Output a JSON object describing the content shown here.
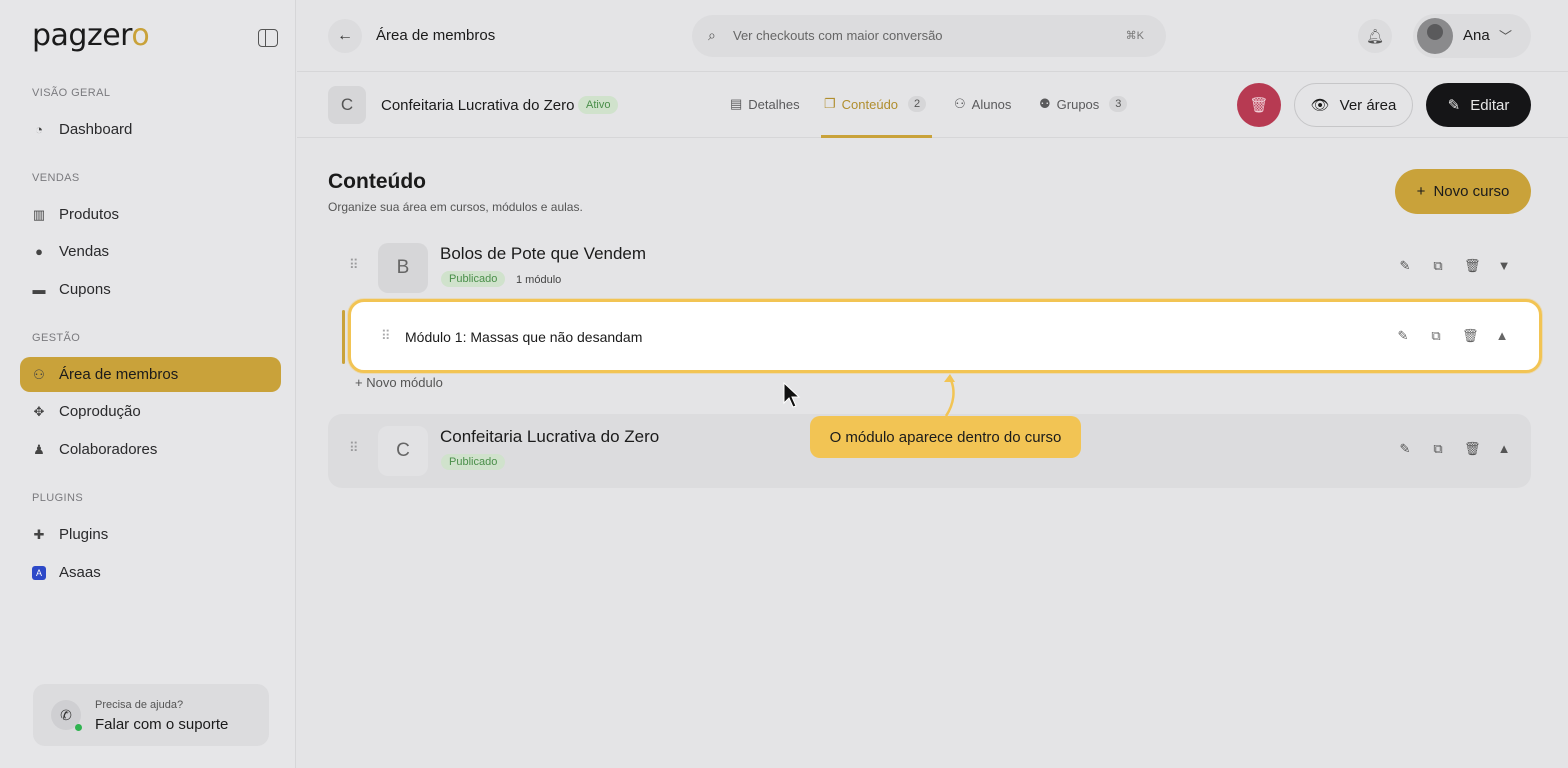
{
  "brand": {
    "name_main": "pagzer",
    "name_accent": "o",
    "accent_color": "#c9a23a"
  },
  "sidebar": {
    "sections": [
      {
        "title": "VISÃO GERAL",
        "items": [
          {
            "label": "Dashboard",
            "icon": "gauge-icon"
          }
        ]
      },
      {
        "title": "VENDAS",
        "items": [
          {
            "label": "Produtos",
            "icon": "box-icon"
          },
          {
            "label": "Vendas",
            "icon": "money-icon"
          },
          {
            "label": "Cupons",
            "icon": "ticket-icon"
          }
        ]
      },
      {
        "title": "GESTÃO",
        "items": [
          {
            "label": "Área de membros",
            "icon": "users-icon",
            "active": true
          },
          {
            "label": "Coprodução",
            "icon": "handshake-icon"
          },
          {
            "label": "Colaboradores",
            "icon": "user-icon"
          }
        ]
      },
      {
        "title": "PLUGINS",
        "items": [
          {
            "label": "Plugins",
            "icon": "puzzle-icon"
          },
          {
            "label": "Asaas",
            "icon": "asaas-icon"
          }
        ]
      }
    ],
    "support": {
      "line1": "Precisa de ajuda?",
      "line2": "Falar com o suporte"
    }
  },
  "topbar": {
    "title": "Área de membros",
    "search_placeholder": "Ver checkouts com maior conversão",
    "search_shortcut": "⌘K",
    "user_name": "Ana"
  },
  "product": {
    "initial": "C",
    "name": "Confeitaria Lucrativa do Zero",
    "status": "Ativo",
    "tabs": [
      {
        "label": "Detalhes",
        "count": ""
      },
      {
        "label": "Conteúdo",
        "count": "2",
        "active": true
      },
      {
        "label": "Alunos",
        "count": ""
      },
      {
        "label": "Grupos",
        "count": "3"
      }
    ],
    "view_label": "Ver área",
    "edit_label": "Editar"
  },
  "content": {
    "title": "Conteúdo",
    "subtitle": "Organize sua área em cursos, módulos e aulas.",
    "new_course_label": "Novo curso",
    "courses": [
      {
        "initial": "B",
        "title": "Bolos de Pote que Vendem",
        "status": "Publicado",
        "modules": "1 módulo"
      },
      {
        "initial": "C",
        "title": "Confeitaria Lucrativa do Zero",
        "status": "Publicado",
        "modules": ""
      }
    ],
    "module": {
      "title": "Módulo 1: Massas que não desandam"
    },
    "new_module_label": "Novo módulo"
  },
  "tooltip": {
    "text": "O módulo aparece dentro do curso"
  }
}
